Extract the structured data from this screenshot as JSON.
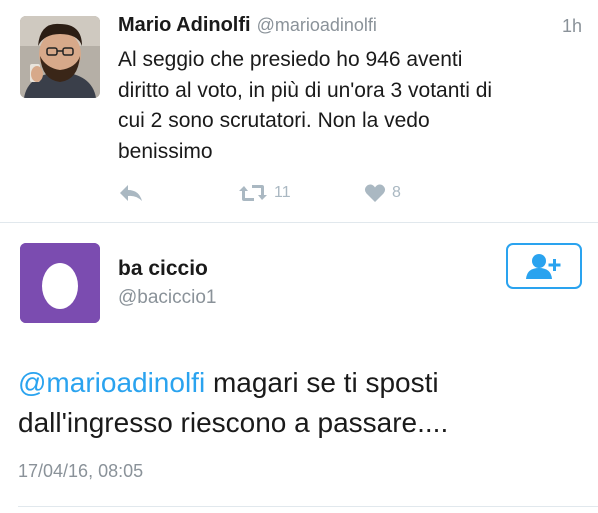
{
  "tweet1": {
    "author_name": "Mario Adinolfi",
    "author_handle": "@marioadinolfi",
    "time": "1h",
    "text_lines": [
      "Al seggio che presiedo ho 946 aventi",
      "diritto al voto, in più di un'ora 3 votanti di",
      "cui 2 sono scrutatori. Non la vedo",
      "benissimo"
    ],
    "retweet_count": "11",
    "like_count": "8",
    "icons": [
      "reply-icon",
      "retweet-icon",
      "heart-icon"
    ]
  },
  "tweet2": {
    "author_name": "ba ciccio",
    "author_handle": "@baciccio1",
    "mention": "@marioadinolfi",
    "text_after_mention": " magari se ti sposti",
    "text_line2": "dall'ingresso riescono a passare....",
    "date": "17/04/16, 08:05",
    "icons": [
      "egg-avatar-icon",
      "follow-user-icon"
    ]
  },
  "colors": {
    "accent": "#2aa3ef",
    "muted": "#8a9299",
    "action_gray": "#aab8c2",
    "egg_avatar_bg": "#7b4cb0"
  }
}
